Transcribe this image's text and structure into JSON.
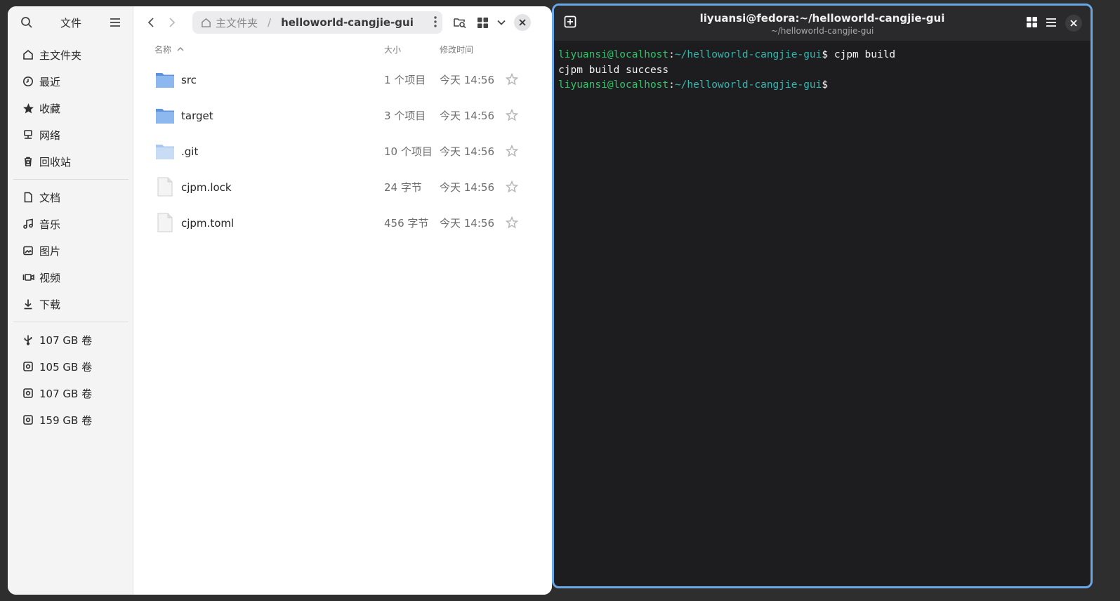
{
  "file_manager": {
    "sidebar": {
      "title": "文件",
      "places": [
        {
          "label": "主文件夹",
          "icon": "home-icon"
        },
        {
          "label": "最近",
          "icon": "clock-icon"
        },
        {
          "label": "收藏",
          "icon": "star-icon"
        },
        {
          "label": "网络",
          "icon": "network-icon"
        },
        {
          "label": "回收站",
          "icon": "trash-icon"
        }
      ],
      "bookmarks": [
        {
          "label": "文档",
          "icon": "document-icon"
        },
        {
          "label": "音乐",
          "icon": "music-icon"
        },
        {
          "label": "图片",
          "icon": "picture-icon"
        },
        {
          "label": "视频",
          "icon": "video-icon"
        },
        {
          "label": "下载",
          "icon": "download-icon"
        }
      ],
      "volumes": [
        {
          "label": "107 GB 卷",
          "icon": "usb-drive-icon"
        },
        {
          "label": "105 GB 卷",
          "icon": "drive-icon"
        },
        {
          "label": "107 GB 卷",
          "icon": "drive-icon"
        },
        {
          "label": "159 GB 卷",
          "icon": "drive-icon"
        }
      ]
    },
    "pathbar": {
      "home": "主文件夹",
      "separator": "/",
      "current": "helloworld-cangjie-gui"
    },
    "columns": {
      "name": "名称",
      "size": "大小",
      "modified": "修改时间"
    },
    "files": [
      {
        "name": "src",
        "size": "1 个项目",
        "modified": "今天 14:56",
        "type": "folder"
      },
      {
        "name": "target",
        "size": "3 个项目",
        "modified": "今天 14:56",
        "type": "folder"
      },
      {
        "name": ".git",
        "size": "10 个项目",
        "modified": "今天 14:56",
        "type": "folder-hidden"
      },
      {
        "name": "cjpm.lock",
        "size": "24 字节",
        "modified": "今天 14:56",
        "type": "file"
      },
      {
        "name": "cjpm.toml",
        "size": "456 字节",
        "modified": "今天 14:56",
        "type": "file"
      }
    ]
  },
  "terminal": {
    "title": "liyuansi@fedora:~/helloworld-cangjie-gui",
    "subtitle": "~/helloworld-cangjie-gui",
    "lines": [
      {
        "user": "liyuansi@localhost",
        "colon": ":",
        "path": "~/helloworld-cangjie-gui",
        "prompt": "$ ",
        "command": "cjpm build"
      },
      {
        "output": "cjpm build success"
      },
      {
        "user": "liyuansi@localhost",
        "colon": ":",
        "path": "~/helloworld-cangjie-gui",
        "prompt": "$",
        "command": ""
      }
    ]
  },
  "colors": {
    "accent_border": "#6aa7e6",
    "prompt_user": "#32c26a",
    "prompt_path": "#33b7b0",
    "folder": "#6aa0e4"
  }
}
